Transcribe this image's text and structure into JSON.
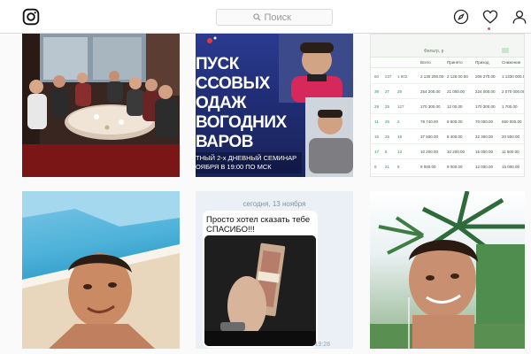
{
  "header": {
    "search_placeholder": "Поиск",
    "icons": [
      "instagram-logo-icon",
      "compass-icon",
      "heart-icon",
      "profile-icon"
    ],
    "notification_dot_color": "#ed4956"
  },
  "posts": [
    {
      "kind": "group-photo"
    },
    {
      "kind": "seminar-promo",
      "headline_lines": [
        "ПУСК",
        "ССОВЫХ",
        "ОДАЖ",
        "ВОГОДНИХ",
        "ВАРОВ"
      ],
      "sub_lines": [
        "ТНЫЙ 2-х ДНЕВНЫЙ СЕМИНАР",
        "ОЯБРЯ В 19:00 ПО МСК"
      ]
    },
    {
      "kind": "spreadsheet",
      "header_label": "Фильтр, р",
      "columns": [
        "Всего",
        "Принято",
        "Приход",
        "Снижение"
      ],
      "rows": [
        [
          "60",
          "237",
          "1 902",
          "2 130 200.00",
          "2 128 00.00",
          "209 270.00",
          "1 1330 000.00"
        ],
        [
          "39",
          "27",
          "28",
          "254 200.00",
          "21 000.00",
          "224 000.00",
          "2 070 000.00"
        ],
        [
          "29",
          "25",
          "127",
          "170 300.00",
          "12 00.00",
          "170 300.00",
          "1 700.00"
        ],
        [
          "11",
          "25",
          "2",
          "78 740.00",
          "8 500.00",
          "70 000.00",
          "650 000.00"
        ],
        [
          "16",
          "25",
          "18",
          "37 500.00",
          "8 400.00",
          "32 300.00",
          "20 500.00"
        ],
        [
          "17",
          "8",
          "13",
          "10 200.00",
          "10 200.00",
          "15 000.00",
          "11 500.00"
        ],
        [
          "8",
          "21",
          "8",
          "9 000.00",
          "9 000.00",
          "12 000.00",
          "15 000.00"
        ]
      ]
    },
    {
      "kind": "beach-selfie"
    },
    {
      "kind": "chat-screenshot",
      "date": "сегодня, 13 ноября",
      "message_lines": [
        "Просто хотел сказать тебе",
        "СПАСИБО!!!"
      ],
      "time": "19:28"
    },
    {
      "kind": "palm-selfie"
    }
  ]
}
